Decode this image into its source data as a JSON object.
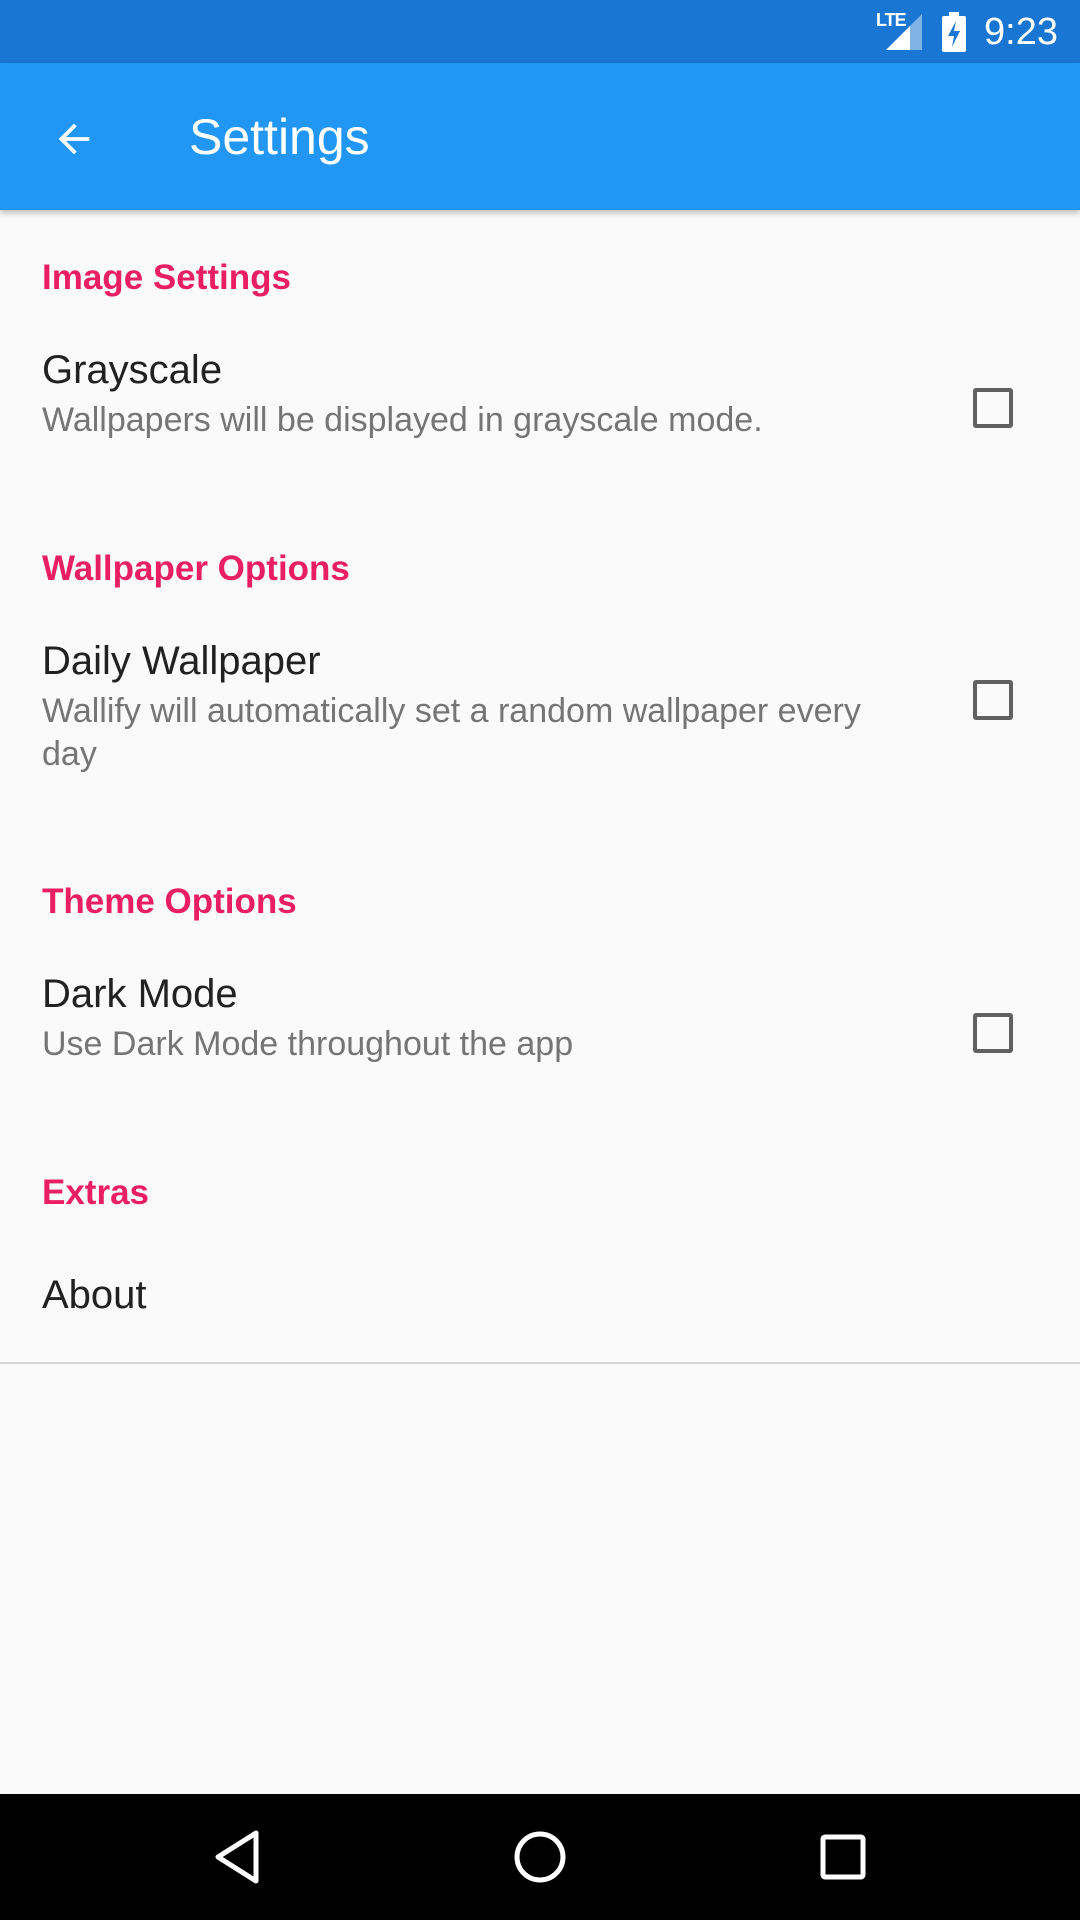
{
  "status_bar": {
    "network_label": "LTE",
    "time": "9:23",
    "icons": [
      "lte-signal-icon",
      "battery-charging-icon"
    ]
  },
  "app_bar": {
    "title": "Settings",
    "back_icon": "arrow-back-icon",
    "color": "#2196f3"
  },
  "sections": [
    {
      "header": "Image Settings",
      "items": [
        {
          "title": "Grayscale",
          "summary": "Wallpapers will be displayed in grayscale mode.",
          "checked": false
        }
      ]
    },
    {
      "header": "Wallpaper Options",
      "items": [
        {
          "title": "Daily Wallpaper",
          "summary": "Wallify will automatically set a random wallpaper every day",
          "checked": false
        }
      ]
    },
    {
      "header": "Theme Options",
      "items": [
        {
          "title": "Dark Mode",
          "summary": "Use Dark Mode throughout the app",
          "checked": false
        }
      ]
    },
    {
      "header": "Extras",
      "items": [
        {
          "title": "About"
        }
      ]
    }
  ],
  "nav_bar": {
    "icons": [
      "back-triangle-icon",
      "home-circle-icon",
      "recents-square-icon"
    ]
  },
  "colors": {
    "status_bar": "#1976d2",
    "accent": "#e91e63",
    "background": "#fafafa"
  }
}
